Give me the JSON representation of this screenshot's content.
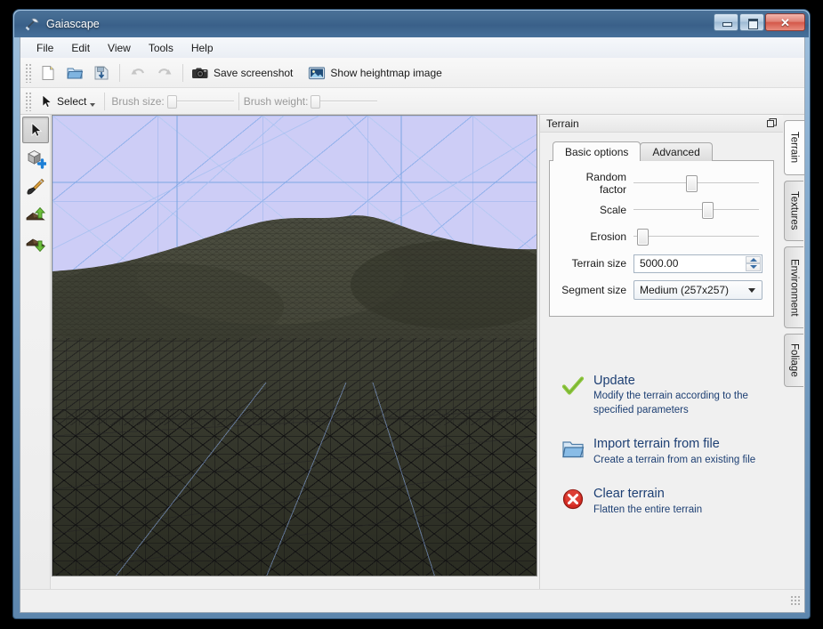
{
  "window": {
    "title": "Gaiascape",
    "app_icon": "pickaxe-icon",
    "caption_buttons": [
      {
        "name": "minimize-button",
        "label": "Minimize",
        "glyph": "minimize-icon"
      },
      {
        "name": "maximize-button",
        "label": "Maximize",
        "glyph": "maximize-icon"
      },
      {
        "name": "close-button",
        "label": "Close",
        "glyph": "close-icon",
        "text": "✕"
      }
    ]
  },
  "menubar": {
    "items": [
      {
        "label": "File"
      },
      {
        "label": "Edit"
      },
      {
        "label": "View"
      },
      {
        "label": "Tools"
      },
      {
        "label": "Help"
      }
    ]
  },
  "toolbar_main": {
    "buttons": [
      {
        "name": "new-button",
        "icon": "new-document-icon",
        "label": "New",
        "enabled": true
      },
      {
        "name": "open-button",
        "icon": "open-folder-icon",
        "label": "Open",
        "enabled": true
      },
      {
        "name": "save-button",
        "icon": "save-icon",
        "label": "Save",
        "enabled": true
      },
      {
        "name": "undo-button",
        "icon": "undo-arrow-icon",
        "label": "Undo",
        "enabled": false
      },
      {
        "name": "redo-button",
        "icon": "redo-arrow-icon",
        "label": "Redo",
        "enabled": false
      }
    ],
    "save_screenshot": {
      "icon": "camera-icon",
      "label": "Save screenshot"
    },
    "show_heightmap": {
      "icon": "image-icon",
      "label": "Show heightmap image"
    }
  },
  "toolbar_tools": {
    "mode": {
      "icon": "cursor-arrow-icon",
      "label": "Select"
    },
    "brush_size": {
      "label": "Brush size:",
      "enabled": false,
      "value_pct": 0
    },
    "brush_weight": {
      "label": "Brush weight:",
      "enabled": false,
      "value_pct": 0
    }
  },
  "tool_palette": {
    "tools": [
      {
        "name": "tool-select",
        "icon": "cursor-arrow-icon",
        "label": "Select",
        "active": true
      },
      {
        "name": "tool-add-object",
        "icon": "add-cube-icon",
        "label": "Add object",
        "active": false
      },
      {
        "name": "tool-paint",
        "icon": "paintbrush-icon",
        "label": "Paint",
        "active": false
      },
      {
        "name": "tool-raise",
        "icon": "raise-terrain-icon",
        "label": "Raise terrain",
        "active": false
      },
      {
        "name": "tool-lower",
        "icon": "lower-terrain-icon",
        "label": "Lower terrain",
        "active": false
      }
    ]
  },
  "viewport": {
    "name": "terrain-3d-viewport",
    "background_color": "#cdcdf6",
    "wireframe_color": "#79a7e8",
    "terrain_color": "#3e4034",
    "mesh_color": "#1c1c1c"
  },
  "panel": {
    "title": "Terrain",
    "undock_icon": "undock-icon",
    "tabs": [
      {
        "label": "Basic options",
        "active": true
      },
      {
        "label": "Advanced",
        "active": false
      }
    ],
    "fields": {
      "random_factor": {
        "label": "Random factor",
        "value_pct": 41
      },
      "scale": {
        "label": "Scale",
        "value_pct": 53
      },
      "erosion": {
        "label": "Erosion",
        "value_pct": 4
      },
      "terrain_size": {
        "label": "Terrain size",
        "value": "5000.00"
      },
      "segment_size": {
        "label": "Segment size",
        "value": "Medium (257x257)"
      }
    }
  },
  "actions": [
    {
      "name": "update-action",
      "icon": "green-check-icon",
      "title": "Update",
      "desc": "Modify the terrain according to the specified parameters"
    },
    {
      "name": "import-terrain-action",
      "icon": "open-folder-icon",
      "title": "Import terrain from file",
      "desc": "Create a terrain from an existing file"
    },
    {
      "name": "clear-terrain-action",
      "icon": "red-error-icon",
      "title": "Clear terrain",
      "desc": "Flatten the entire terrain"
    }
  ],
  "side_tabs": [
    {
      "label": "Terrain",
      "active": true
    },
    {
      "label": "Textures",
      "active": false
    },
    {
      "label": "Environment",
      "active": false
    },
    {
      "label": "Foliage",
      "active": false
    }
  ],
  "statusbar": {
    "text": ""
  }
}
